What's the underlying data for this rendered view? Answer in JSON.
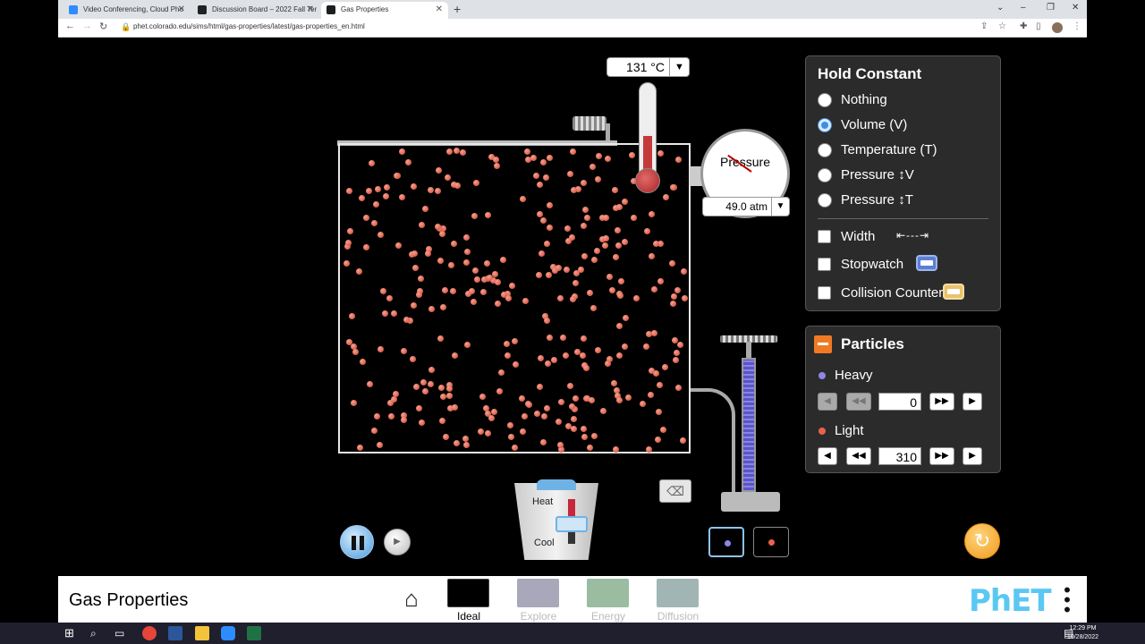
{
  "browser": {
    "tabs": [
      {
        "title": "Video Conferencing, Cloud Pho",
        "favicon_color": "#2d8cff",
        "active": false
      },
      {
        "title": "Discussion Board – 2022 Fall Ter",
        "favicon_color": "#222222",
        "active": false
      },
      {
        "title": "Gas Properties",
        "favicon_color": "#1e1e1e",
        "active": true
      }
    ],
    "url": "phet.colorado.edu/sims/html/gas-properties/latest/gas-properties_en.html"
  },
  "sim": {
    "thermometer": {
      "value": "131 °C"
    },
    "gauge": {
      "label": "Pressure",
      "value": "49.0 atm"
    },
    "hold_constant": {
      "title": "Hold Constant",
      "options": [
        {
          "label": "Nothing",
          "selected": false
        },
        {
          "label": "Volume (V)",
          "selected": true
        },
        {
          "label": "Temperature (T)",
          "selected": false
        },
        {
          "label": "Pressure ↕V",
          "selected": false
        },
        {
          "label": "Pressure ↕T",
          "selected": false
        }
      ],
      "checkboxes": [
        {
          "label": "Width",
          "checked": false
        },
        {
          "label": "Stopwatch",
          "checked": false
        },
        {
          "label": "Collision Counter",
          "checked": false
        }
      ]
    },
    "particles_panel": {
      "title": "Particles",
      "heavy": {
        "label": "Heavy",
        "count": "0",
        "color": "#8f86e8"
      },
      "light": {
        "label": "Light",
        "count": "310",
        "color": "#e8624b"
      }
    },
    "bucket": {
      "heat_label": "Heat",
      "cool_label": "Cool"
    }
  },
  "navbar": {
    "title": "Gas Properties",
    "screens": [
      {
        "label": "Ideal",
        "active": true
      },
      {
        "label": "Explore",
        "active": false
      },
      {
        "label": "Energy",
        "active": false
      },
      {
        "label": "Diffusion",
        "active": false
      }
    ],
    "logo": "PhET"
  },
  "taskbar": {
    "time": "12:29 PM",
    "date": "10/28/2022"
  }
}
